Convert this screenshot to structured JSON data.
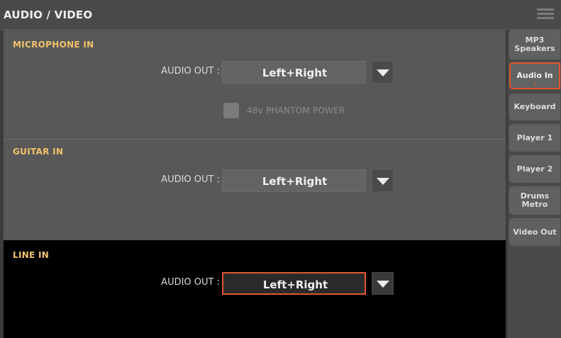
{
  "header": {
    "title": "AUDIO / VIDEO",
    "menu_icon": "hamburger-menu-icon"
  },
  "sections": [
    {
      "title": "MICROPHONE IN",
      "audio_out_label": "AUDIO OUT :",
      "audio_out_value": "Left+Right"
    },
    {
      "title": "GUITAR IN",
      "audio_out_label": "AUDIO OUT :",
      "audio_out_value": "Left+Right"
    },
    {
      "title": "LINE IN",
      "audio_out_label": "AUDIO OUT :",
      "audio_out_value": "Left+Right"
    }
  ],
  "phantom_power": {
    "label": "48v PHANTOM POWER",
    "checked": false,
    "enabled": false
  },
  "tabs": [
    {
      "label": "MP3\nSpeakers"
    },
    {
      "label": "Audio In",
      "active": true
    },
    {
      "label": "Keyboard"
    },
    {
      "label": "Player 1"
    },
    {
      "label": "Player 2"
    },
    {
      "label": "Drums\nMetro"
    },
    {
      "label": "Video Out"
    }
  ],
  "colors": {
    "accent": "#e0572e",
    "section_title": "#f2c16a",
    "active_section_bg": "#000000"
  }
}
